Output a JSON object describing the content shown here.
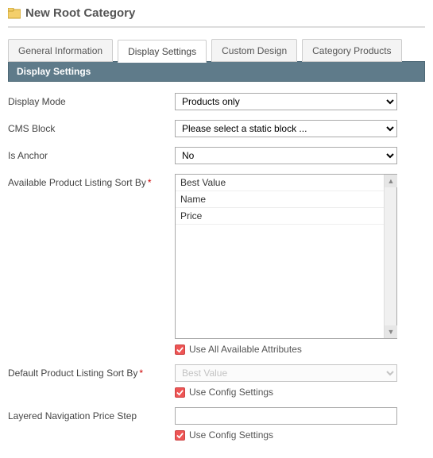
{
  "header": {
    "title": "New Root Category"
  },
  "tabs": [
    {
      "label": "General Information",
      "active": false
    },
    {
      "label": "Display Settings",
      "active": true
    },
    {
      "label": "Custom Design",
      "active": false
    },
    {
      "label": "Category Products",
      "active": false
    }
  ],
  "section": {
    "title": "Display Settings"
  },
  "fields": {
    "display_mode": {
      "label": "Display Mode",
      "value": "Products only"
    },
    "cms_block": {
      "label": "CMS Block",
      "value": "Please select a static block ..."
    },
    "is_anchor": {
      "label": "Is Anchor",
      "value": "No"
    },
    "available_sort": {
      "label": "Available Product Listing Sort By",
      "required": true,
      "options": [
        "Best Value",
        "Name",
        "Price"
      ],
      "use_all_label": "Use All Available Attributes"
    },
    "default_sort": {
      "label": "Default Product Listing Sort By",
      "required": true,
      "value": "Best Value",
      "use_config_label": "Use Config Settings"
    },
    "price_step": {
      "label": "Layered Navigation Price Step",
      "value": "",
      "use_config_label": "Use Config Settings"
    }
  }
}
